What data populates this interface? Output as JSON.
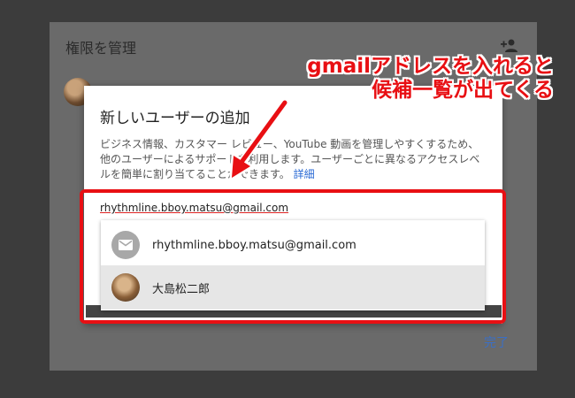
{
  "outer_dialog": {
    "title": "権限を管理",
    "add_user_icon": "add-user-icon",
    "done_label": "完了"
  },
  "inner_dialog": {
    "title": "新しいユーザーの追加",
    "description": "ビジネス情報、カスタマー レビュー、YouTube 動画を管理しやすくするため、他のユーザーによるサポートを利用します。ユーザーごとに異なるアクセスレベルを簡単に割り当てることができます。",
    "more_link": "詳細",
    "email_value": "rhythmline.bboy.matsu@gmail.com"
  },
  "suggestions": [
    {
      "label": "rhythmline.bboy.matsu@gmail.com",
      "icon": "mail-icon",
      "selected": false
    },
    {
      "label": "大島松二郎",
      "icon": "avatar",
      "selected": true
    }
  ],
  "annotation": {
    "line1": "gmailアドレスを入れると",
    "line2": "候補一覧が出てくる"
  },
  "colors": {
    "annotation": "#e80f13",
    "link": "#2a6ad4",
    "overlay": "#3c3c3c"
  }
}
